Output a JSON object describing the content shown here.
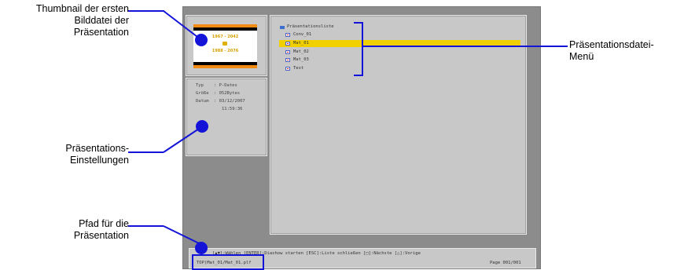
{
  "callouts": {
    "thumbnail": [
      "Thumbnail der ersten",
      "Bilddatei der",
      "Präsentation"
    ],
    "settings": [
      "Präsentations-",
      "Einstellungen"
    ],
    "path": [
      "Pfad für die",
      "Präsentation"
    ],
    "menu": [
      "Präsentationsdatei-",
      "Menü"
    ]
  },
  "thumbnail": {
    "line1": "1967 - 2042",
    "line2": "1988 - 2076"
  },
  "info": {
    "rows": [
      {
        "label": "Typ",
        "value": ": P-Dates"
      },
      {
        "label": "Größe",
        "value": ": 052Bytes"
      },
      {
        "label": "Datum",
        "value": ": 03/12/2007"
      },
      {
        "label": "",
        "value": "11:59:36"
      }
    ]
  },
  "list": {
    "title": "Präsentationsliste",
    "items": [
      "Conv_01",
      "Mat_01",
      "Mat_02",
      "Mat_03",
      "Test"
    ],
    "selected": "Mat_01"
  },
  "status": {
    "help": "[▲▼]:Wählen [ENTER]:Diashow starten [ESC]:Liste schließen [□]:Nächste [△]:Vorige",
    "path": "TOP)Mat_01/Mat_01.plf",
    "page": "Page 001/001"
  },
  "colors": {
    "accent": "#1414d8",
    "selection": "#f2d000",
    "screen_bg": "#8c8c8c",
    "panel_bg": "#c8c8c8"
  }
}
